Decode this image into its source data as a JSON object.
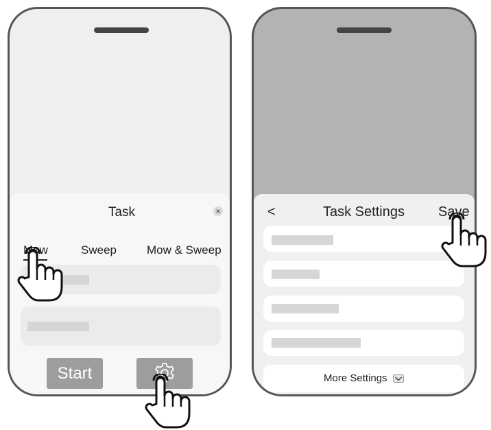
{
  "left_screen": {
    "sheet_title": "Task",
    "tabs": [
      {
        "label": "Mow",
        "selected": true
      },
      {
        "label": "Sweep",
        "selected": false
      },
      {
        "label": "Mow & Sweep",
        "selected": false
      }
    ],
    "close_glyph": "×",
    "start_label": "Start",
    "settings_icon": "gear-icon"
  },
  "right_screen": {
    "back_glyph": "<",
    "title": "Task Settings",
    "save_label": "Save",
    "more_settings_label": "More Settings",
    "more_settings_icon": "chevron-down-icon"
  },
  "colors": {
    "phone_border": "#555555",
    "screen_light": "#efefef",
    "screen_dark": "#b3b3b3",
    "sheet": "#f7f7f7",
    "button_gray": "#9d9d9d",
    "placeholder": "#d6d6d6"
  }
}
